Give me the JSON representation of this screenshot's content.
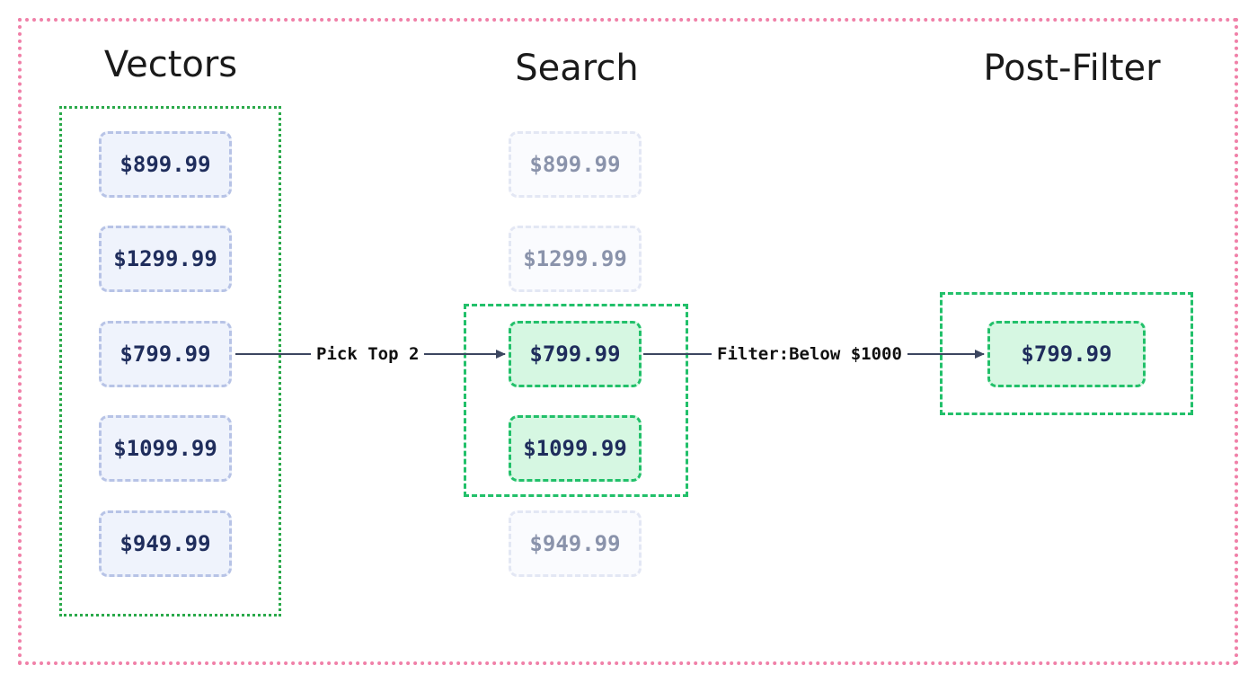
{
  "columns": {
    "vectors": {
      "title": "Vectors",
      "items": [
        "$899.99",
        "$1299.99",
        "$799.99",
        "$1099.99",
        "$949.99"
      ]
    },
    "search": {
      "title": "Search",
      "items": [
        "$899.99",
        "$1299.99",
        "$799.99",
        "$1099.99",
        "$949.99"
      ]
    },
    "post_filter": {
      "title": "Post-Filter",
      "items": [
        "$799.99"
      ]
    }
  },
  "edges": {
    "pick_top": "Pick Top 2",
    "filter": "Filter:Below $1000"
  },
  "colors": {
    "frame": "#f080a8",
    "vector_box": "#2aa94a",
    "selected_box": "#22c06a",
    "chip_blue_bg": "#eff3fc",
    "chip_green_bg": "#d6f7e2",
    "text_dark": "#1f2d5c",
    "text_faded": "#8a93ab",
    "arrow": "#3c4660"
  }
}
